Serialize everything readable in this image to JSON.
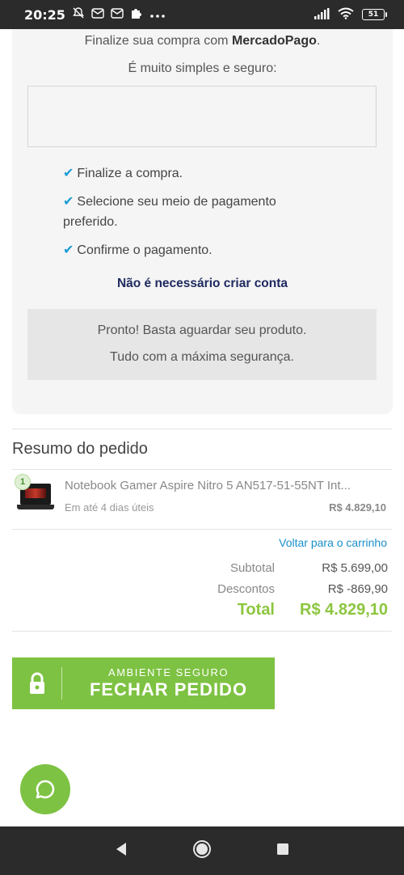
{
  "status_bar": {
    "time": "20:25",
    "icons": [
      "alarm-off-icon",
      "mail-icon",
      "mail-icon",
      "puzzle-icon",
      "more-icon"
    ],
    "battery": "51"
  },
  "mercadopago": {
    "line1_prefix": "Finalize sua compra com ",
    "line1_brand": "MercadoPago",
    "line1_suffix": ".",
    "line2": "É muito simples e seguro:",
    "steps": [
      "Finalize a compra.",
      "Selecione seu meio de pagamento preferido.",
      "Confirme o pagamento."
    ],
    "no_account": "Não é necessário criar conta",
    "ready_line1": "Pronto! Basta aguardar seu produto.",
    "ready_line2": "Tudo com a máxima segurança."
  },
  "summary": {
    "title": "Resumo do pedido",
    "item": {
      "quantity": "1",
      "name": "Notebook Gamer Aspire Nitro 5 AN517-51-55NT Int...",
      "delivery": "Em até 4 dias úteis",
      "price": "R$ 4.829,10"
    },
    "back_link": "Voltar para o carrinho",
    "subtotal_label": "Subtotal",
    "subtotal_value": "R$ 5.699,00",
    "discount_label": "Descontos",
    "discount_value": "R$ -869,90",
    "total_label": "Total",
    "total_value": "R$ 4.829,10"
  },
  "checkout_button": {
    "sub_label": "AMBIENTE SEGURO",
    "main_label": "FECHAR PEDIDO"
  },
  "colors": {
    "accent_green": "#7dc242",
    "total_green": "#8cc63f",
    "link_blue": "#1a8fc8",
    "check_blue": "#1a9bd7",
    "navy": "#1f2a60"
  }
}
